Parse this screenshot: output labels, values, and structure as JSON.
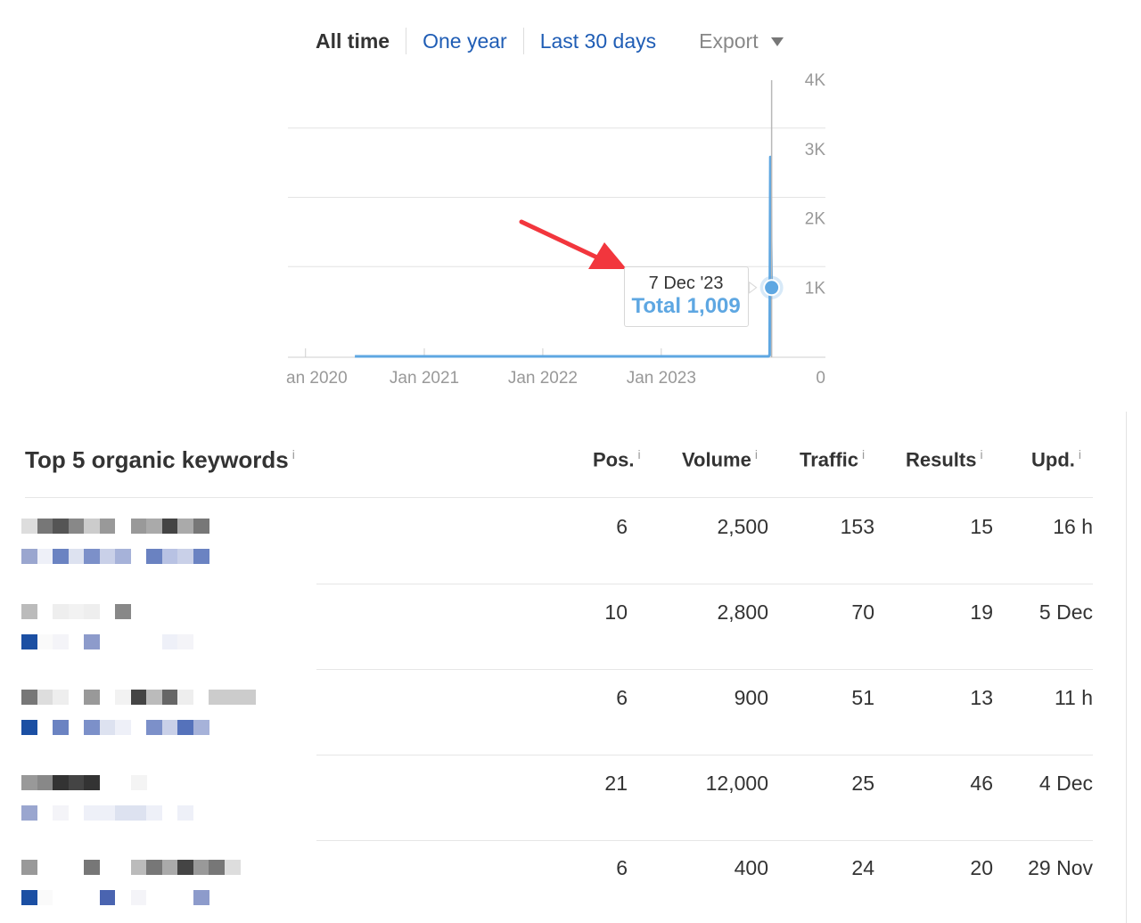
{
  "range": {
    "tabs": [
      {
        "label": "All time",
        "active": true
      },
      {
        "label": "One year",
        "active": false
      },
      {
        "label": "Last 30 days",
        "active": false
      }
    ],
    "export_label": "Export"
  },
  "chart_data": {
    "type": "line",
    "x_tick_labels": [
      "an 2020",
      "Jan 2021",
      "Jan 2022",
      "Jan 2023"
    ],
    "y_tick_labels": [
      "4K",
      "3K",
      "2K",
      "1K",
      "0"
    ],
    "ylim": [
      0,
      4000
    ],
    "grid": true,
    "series": [
      {
        "color": "#5ea7e2",
        "points": [
          {
            "x": "2020-06",
            "y": 0
          },
          {
            "x": "2023-11-27",
            "y": 0
          },
          {
            "x": "2023-12-01",
            "y": 30
          },
          {
            "x": "2023-12-02",
            "y": 1500
          },
          {
            "x": "2023-12-03",
            "y": 2900
          },
          {
            "x": "2023-12-05",
            "y": 1800
          },
          {
            "x": "2023-12-07",
            "y": 1009
          }
        ]
      }
    ],
    "tooltip": {
      "date": "7 Dec '23",
      "total_label": "Total 1,009"
    }
  },
  "keywords": {
    "title": "Top 5 organic keywords",
    "info_glyph": "i",
    "columns": [
      "Pos.",
      "Volume",
      "Traffic",
      "Results",
      "Upd."
    ],
    "rows": [
      {
        "pos": "6",
        "volume": "2,500",
        "traffic": "153",
        "results": "15",
        "upd": "16 h"
      },
      {
        "pos": "10",
        "volume": "2,800",
        "traffic": "70",
        "results": "19",
        "upd": "5 Dec"
      },
      {
        "pos": "6",
        "volume": "900",
        "traffic": "51",
        "results": "13",
        "upd": "11 h"
      },
      {
        "pos": "21",
        "volume": "12,000",
        "traffic": "25",
        "results": "46",
        "upd": "4 Dec"
      },
      {
        "pos": "6",
        "volume": "400",
        "traffic": "24",
        "results": "20",
        "upd": "29 Nov"
      }
    ]
  },
  "colors": {
    "accent": "#5ea7e2",
    "link": "#1f5db5",
    "arrow": "#f2363d"
  }
}
